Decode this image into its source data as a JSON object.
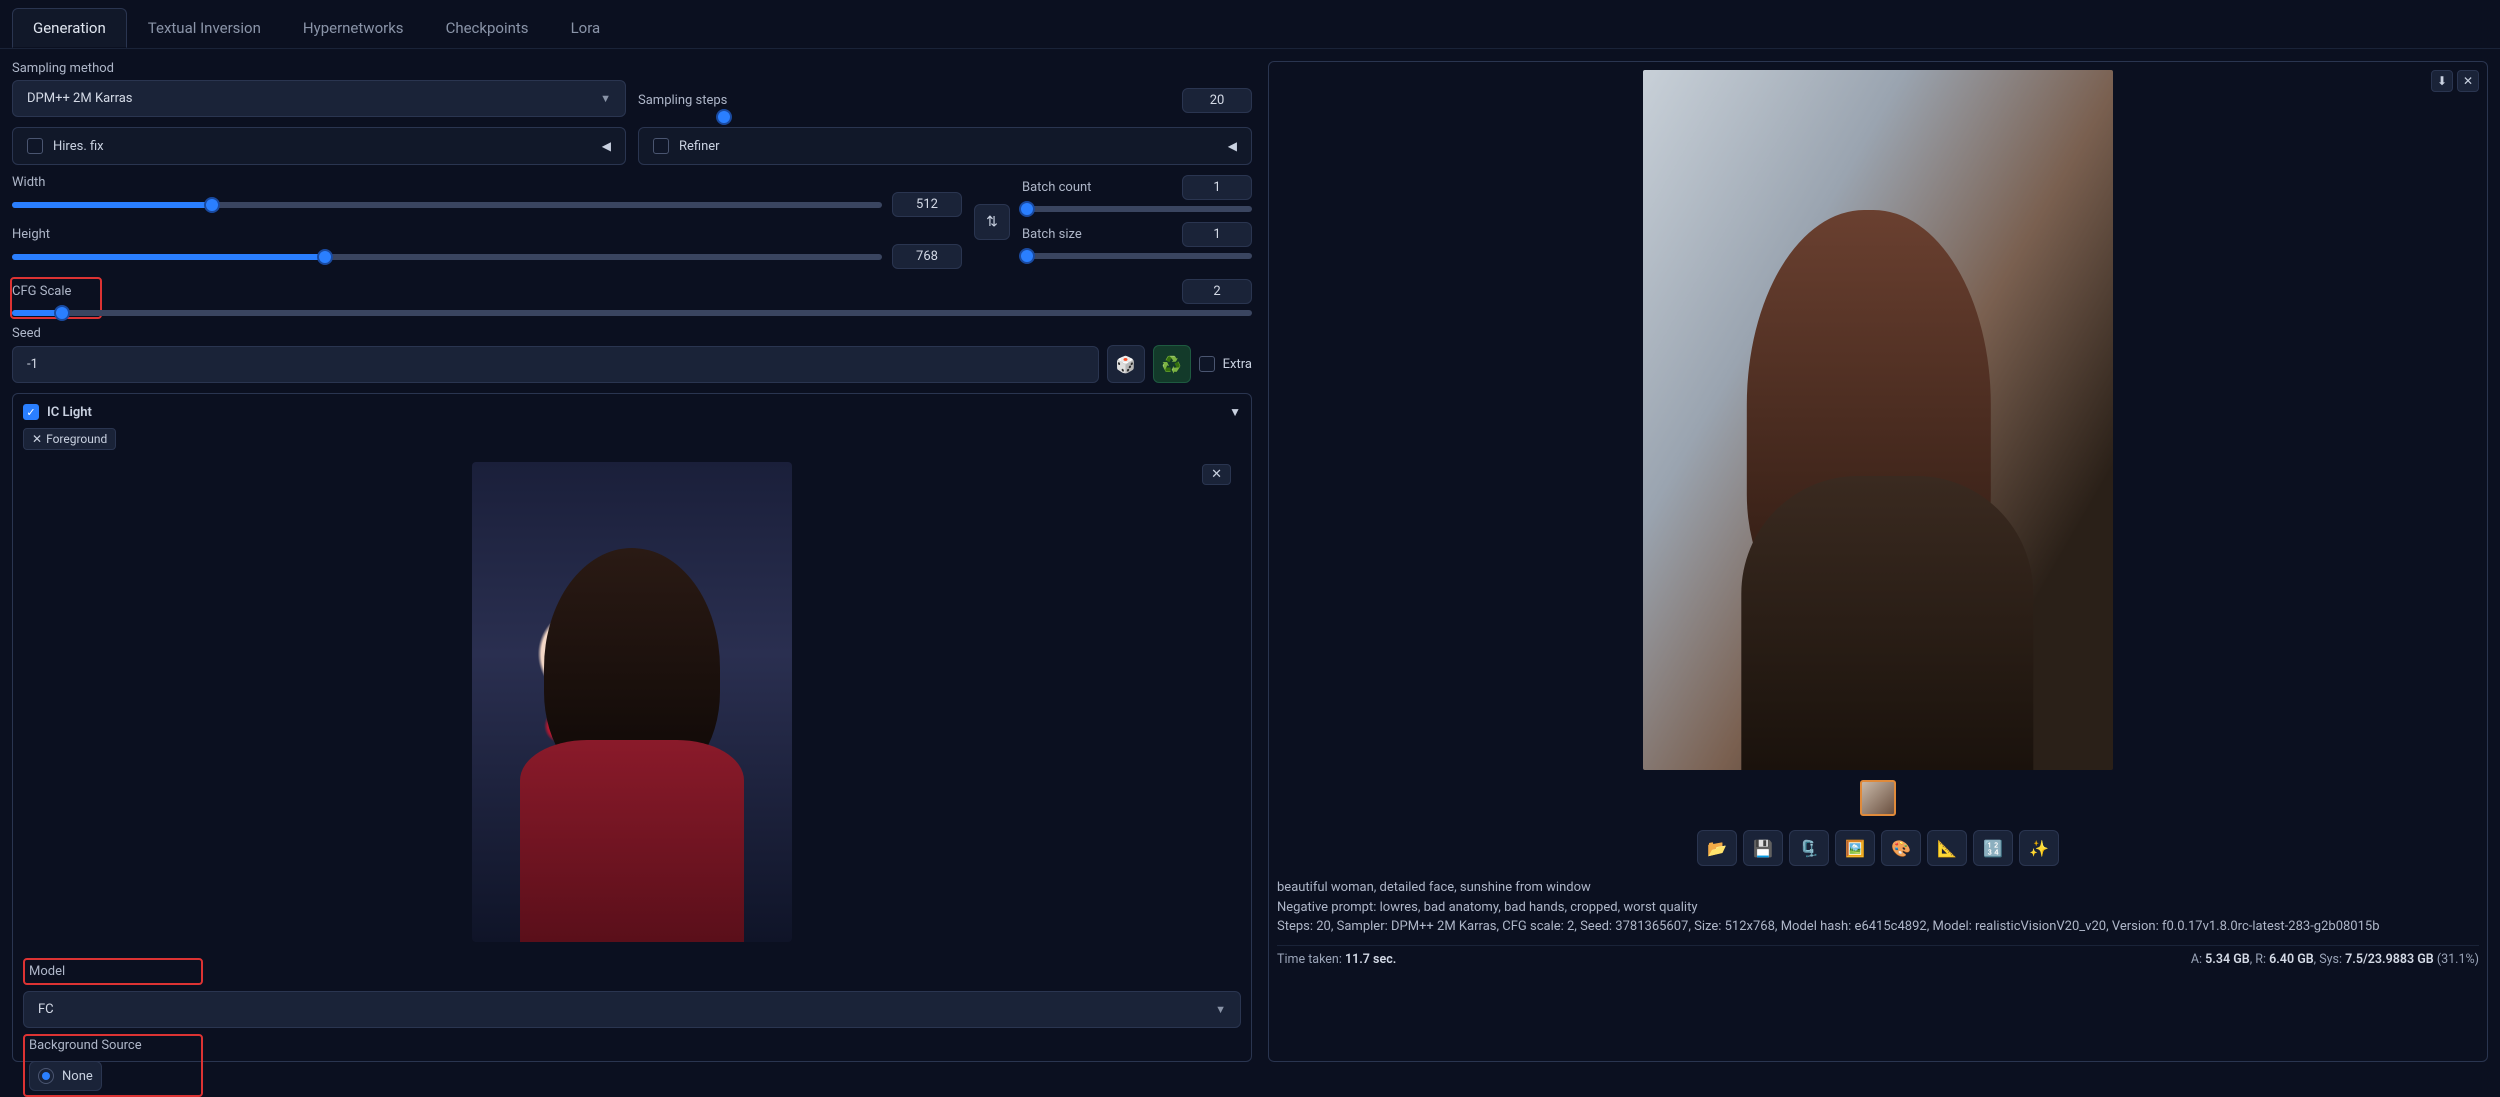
{
  "tabs": [
    "Generation",
    "Textual Inversion",
    "Hypernetworks",
    "Checkpoints",
    "Lora"
  ],
  "activeTab": "Generation",
  "sampling": {
    "methodLabel": "Sampling method",
    "methodValue": "DPM++ 2M Karras",
    "stepsLabel": "Sampling steps",
    "stepsValue": "20"
  },
  "accordions": {
    "hires": "Hires. fix",
    "refiner": "Refiner"
  },
  "dims": {
    "widthLabel": "Width",
    "widthValue": "512",
    "heightLabel": "Height",
    "heightValue": "768",
    "batchCountLabel": "Batch count",
    "batchCountValue": "1",
    "batchSizeLabel": "Batch size",
    "batchSizeValue": "1"
  },
  "cfg": {
    "label": "CFG Scale",
    "value": "2"
  },
  "seed": {
    "label": "Seed",
    "value": "-1",
    "extraLabel": "Extra"
  },
  "icLight": {
    "title": "IC Light",
    "tag": "Foreground",
    "modelLabel": "Model",
    "modelValue": "FC",
    "bgLabel": "Background Source",
    "bgValue": "None"
  },
  "result": {
    "prompt": "beautiful woman, detailed face, sunshine from window",
    "negLabel": "Negative prompt:",
    "negValue": "lowres, bad anatomy, bad hands, cropped, worst quality",
    "params": "Steps: 20, Sampler: DPM++ 2M Karras, CFG scale: 2, Seed: 3781365607, Size: 512x768, Model hash: e6415c4892, Model: realisticVisionV20_v20, Version: f0.0.17v1.8.0rc-latest-283-g2b08015b",
    "timeLabel": "Time taken:",
    "timeValue": "11.7 sec."
  },
  "footerStats": {
    "aLabel": "A:",
    "aVal": "5.34 GB",
    "rLabel": "R:",
    "rVal": "6.40 GB",
    "sysLabel": "Sys:",
    "sysVal": "7.5/23.9883 GB",
    "sysPct": "(31.1%)"
  },
  "icons": {
    "dice": "🎲",
    "recycle": "♻️",
    "swap": "⇅",
    "folder": "📂",
    "save": "💾",
    "zip": "🗜️",
    "image": "🖼️",
    "palette": "🎨",
    "ruler": "📐",
    "grid": "🔢",
    "sparkle": "✨",
    "download": "⬇",
    "close": "✕",
    "triLeft": "◀",
    "triDown": "▼",
    "dropdown": "▼",
    "check": "✓",
    "tagX": "✕"
  }
}
